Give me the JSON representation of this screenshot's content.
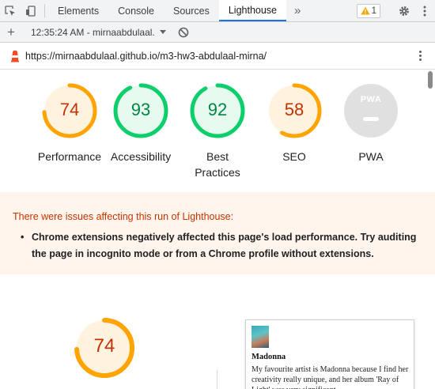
{
  "devtools": {
    "tabs": [
      {
        "label": "Elements"
      },
      {
        "label": "Console"
      },
      {
        "label": "Sources"
      },
      {
        "label": "Lighthouse"
      }
    ],
    "overflow": "»",
    "warnings_count": "1",
    "icons": [
      "inspect-element-icon",
      "device-toggle-icon",
      "warning-icon",
      "gear-icon",
      "kebab-menu-icon"
    ]
  },
  "report_toolbar": {
    "add_label": "+",
    "report_select": "12:35:24 AM - mirnaabdulaal.",
    "icons": [
      "plus-icon",
      "chevron-down-icon",
      "clear-icon"
    ]
  },
  "url_bar": {
    "url": "https://mirnaabdulaal.github.io/m3-hw3-abdulaal-mirna/",
    "icons": [
      "lighthouse-logo-icon",
      "kebab-menu-icon"
    ]
  },
  "scores": [
    {
      "label": "Performance",
      "value": "74",
      "score": 0.74,
      "status": "average"
    },
    {
      "label": "Accessibility",
      "value": "93",
      "score": 0.93,
      "status": "pass"
    },
    {
      "label_line1": "Best",
      "label_line2": "Practices",
      "value": "92",
      "score": 0.92,
      "status": "pass"
    },
    {
      "label": "SEO",
      "value": "58",
      "score": 0.58,
      "status": "average"
    },
    {
      "label": "PWA",
      "value": "",
      "badge_text": "PWA",
      "status": "na"
    }
  ],
  "warning": {
    "title": "There were issues affecting this run of Lighthouse:",
    "items": [
      "Chrome extensions negatively affected this page's load performance. Try auditing the page in incognito mode or from a Chrome profile without extensions."
    ]
  },
  "performance_detail": {
    "value": "74",
    "score": 0.74
  },
  "screenshot_preview": {
    "title": "Madonna",
    "body": "My favourite artist is Madonna because I find her creativity really unique, and her album 'Ray of Light' was very significant..."
  },
  "colors": {
    "average_stroke": "#ffa400",
    "average_fill": "#fff3e0",
    "average_text": "#c33300",
    "pass_stroke": "#0cce6b",
    "pass_fill": "#e6faf0",
    "pass_text": "#018642",
    "na": "#e0e0e0",
    "accent": "#1a73e8",
    "warning_bg": "#fff5ec"
  }
}
